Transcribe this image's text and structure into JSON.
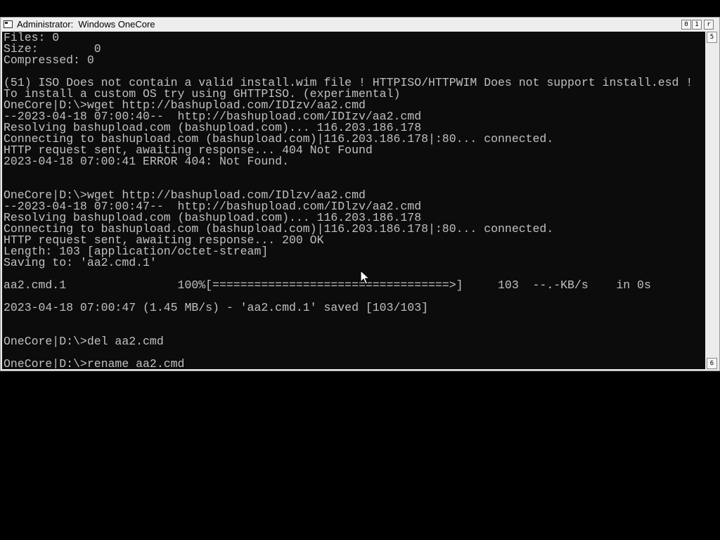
{
  "window": {
    "title": "Administrator:  Windows OneCore",
    "buttons": {
      "minimize": "0",
      "maximize": "1",
      "close": "r"
    }
  },
  "scrollbar": {
    "up": "5",
    "down": "6"
  },
  "console": {
    "lines": [
      "Files: 0",
      "Size:        0",
      "Compressed: 0",
      "",
      "(51) ISO Does not contain a valid install.wim file ! HTTPISO/HTTPWIM Does not support install.esd !",
      "To install a custom OS try using GHTTPISO. (experimental)",
      "OneCore|D:\\>wget http://bashupload.com/IDIzv/aa2.cmd",
      "--2023-04-18 07:00:40--  http://bashupload.com/IDIzv/aa2.cmd",
      "Resolving bashupload.com (bashupload.com)... 116.203.186.178",
      "Connecting to bashupload.com (bashupload.com)|116.203.186.178|:80... connected.",
      "HTTP request sent, awaiting response... 404 Not Found",
      "2023-04-18 07:00:41 ERROR 404: Not Found.",
      "",
      "",
      "OneCore|D:\\>wget http://bashupload.com/IDlzv/aa2.cmd",
      "--2023-04-18 07:00:47--  http://bashupload.com/IDlzv/aa2.cmd",
      "Resolving bashupload.com (bashupload.com)... 116.203.186.178",
      "Connecting to bashupload.com (bashupload.com)|116.203.186.178|:80... connected.",
      "HTTP request sent, awaiting response... 200 OK",
      "Length: 103 [application/octet-stream]",
      "Saving to: 'aa2.cmd.1'",
      "",
      "aa2.cmd.1                100%[==================================>]     103  --.-KB/s    in 0s",
      "",
      "2023-04-18 07:00:47 (1.45 MB/s) - 'aa2.cmd.1' saved [103/103]",
      "",
      "",
      "OneCore|D:\\>del aa2.cmd",
      "",
      "OneCore|D:\\>rename aa2.cmd"
    ]
  },
  "colors": {
    "console_background": "#0c0c0c",
    "console_text": "#c0c0c0",
    "desktop": "#000000",
    "window_frame": "#ececec"
  },
  "icons": {
    "title": "console-window-icon",
    "pointer": "mouse-pointer-icon"
  }
}
